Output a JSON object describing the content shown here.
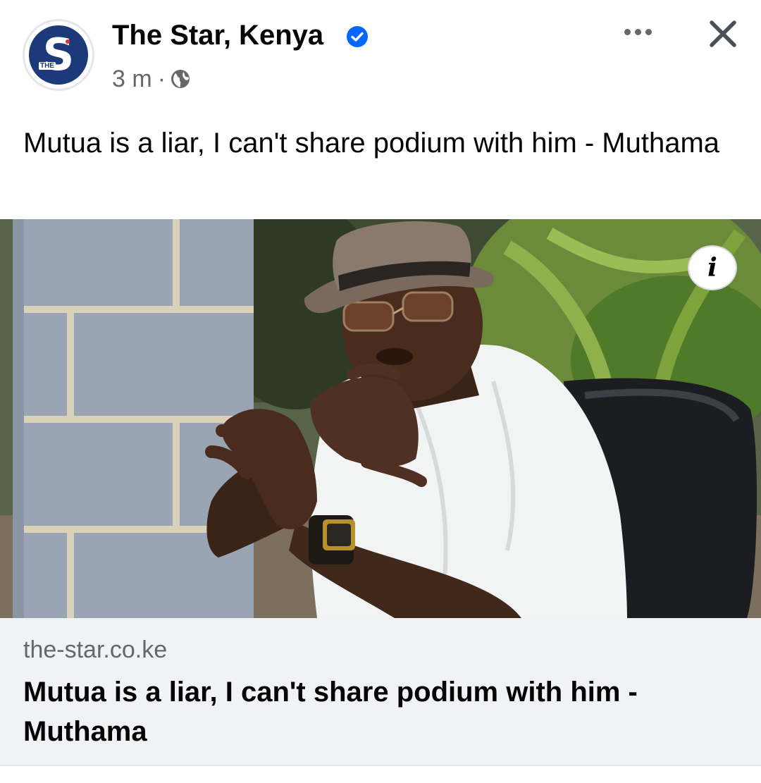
{
  "post": {
    "page_name": "The Star, Kenya",
    "verified_icon": "verified-badge-icon",
    "time_ago": "3 m",
    "separator": "·",
    "audience_icon": "globe-icon",
    "caption": "Mutua is a liar, I can't share podium with him - Muthama"
  },
  "avatar": {
    "letter": "S",
    "small_text": "THE",
    "brand_color": "#1c3a7a"
  },
  "actions": {
    "more_icon": "more-options-icon",
    "close_icon": "close-icon",
    "info_label": "i"
  },
  "link_preview": {
    "domain": "the-star.co.ke",
    "title": "Mutua is a liar, I can't share podium with him - Muthama"
  },
  "colors": {
    "verified_blue": "#0866ff",
    "secondary_text": "#65676b",
    "card_background": "#f0f2f5"
  }
}
